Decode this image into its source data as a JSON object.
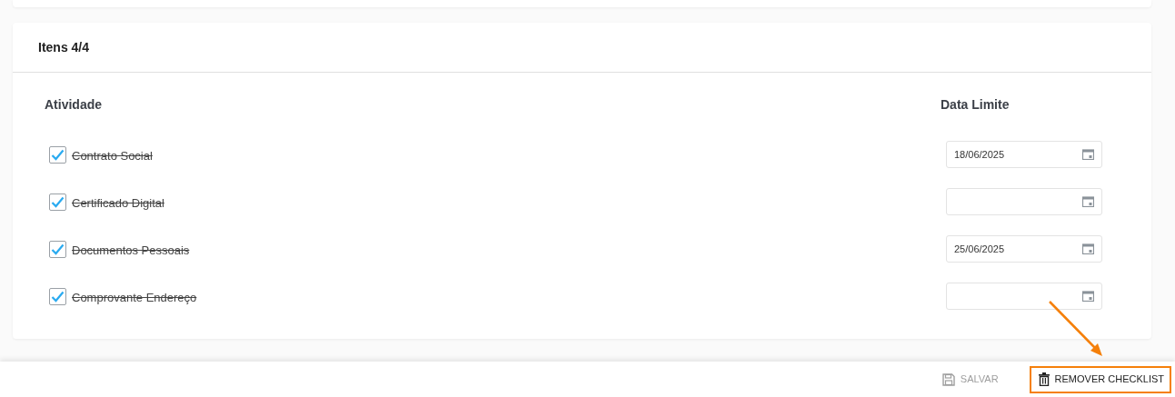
{
  "card": {
    "title": "Itens 4/4",
    "columns": [
      "Atividade",
      "Data Limite"
    ],
    "items": [
      {
        "label": "Contrato Social",
        "checked": true,
        "date": "18/06/2025"
      },
      {
        "label": "Certificado Digital",
        "checked": true
      },
      {
        "label": "Documentos Pessoais",
        "checked": true,
        "date": "25/06/2025"
      },
      {
        "label": "Comprovante Endereço",
        "checked": true
      }
    ]
  },
  "footer": {
    "buttons": [
      {
        "label": "SALVAR",
        "kind": "save",
        "disabled": true,
        "highlighted": false
      },
      {
        "label": "REMOVER CHECKLIST",
        "kind": "delete",
        "disabled": false,
        "highlighted": true
      }
    ]
  }
}
